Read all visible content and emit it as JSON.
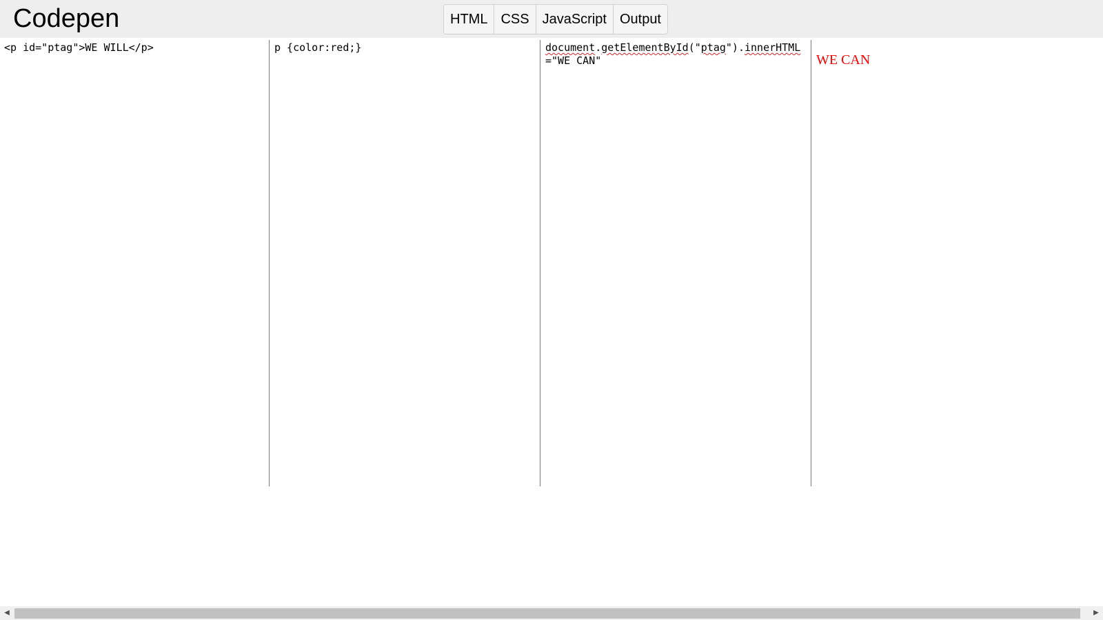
{
  "header": {
    "title": "Codepen",
    "tabs": [
      {
        "label": "HTML"
      },
      {
        "label": "CSS"
      },
      {
        "label": "JavaScript"
      },
      {
        "label": "Output"
      }
    ]
  },
  "editors": {
    "html": "<p id=\"ptag\">WE WILL</p>",
    "css": "p {color:red;}",
    "js_parts": {
      "p1": "document",
      "p2": ".",
      "p3": "getElementById",
      "p4": "(\"",
      "p5": "ptag",
      "p6": "\").",
      "p7": "innerHTML",
      "p8": "=\"WE CAN\""
    }
  },
  "output": {
    "text": "WE CAN",
    "color": "#ff0000"
  },
  "scrollbar": {
    "left_icon": "scroll-left-arrow-icon",
    "right_icon": "scroll-right-arrow-icon"
  }
}
